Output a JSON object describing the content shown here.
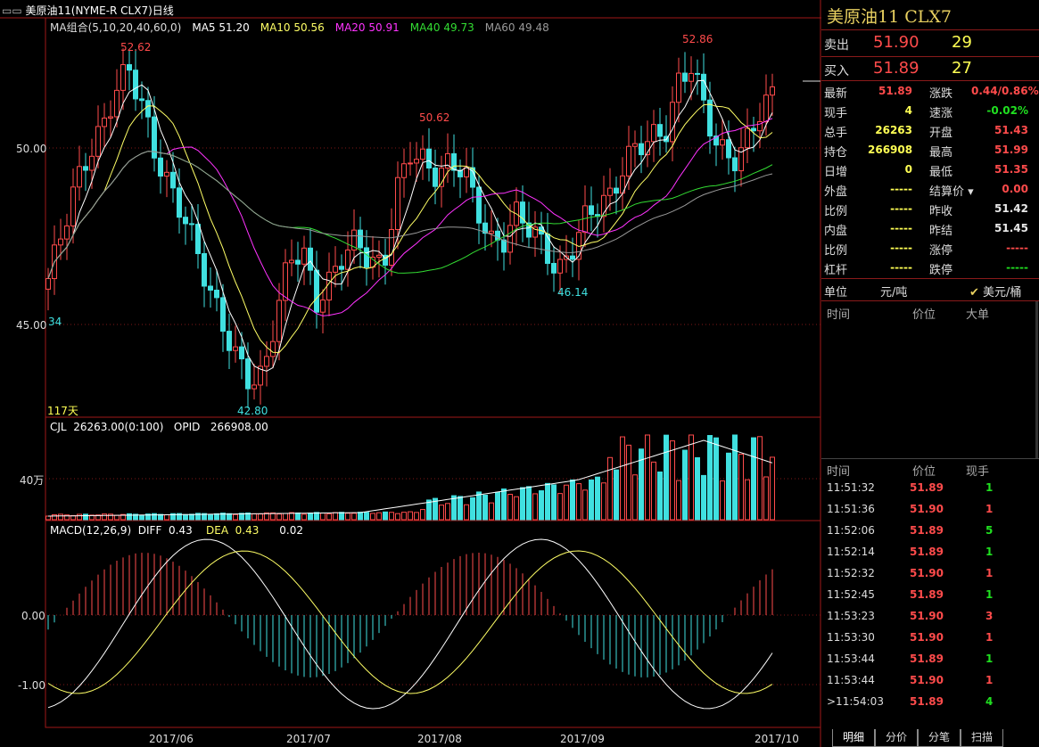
{
  "window": {
    "title": "美原油11(NYME-R CLX7)日线"
  },
  "ma_legend": {
    "group": "MA组合(5,10,20,40,60,0)",
    "ma5": "MA5 51.20",
    "ma10": "MA10 50.56",
    "ma20": "MA20 50.91",
    "ma40": "MA40 49.73",
    "ma60": "MA60 49.48",
    "colors": {
      "ma5": "#ffffff",
      "ma10": "#ffff66",
      "ma20": "#ff33ff",
      "ma40": "#33dd33",
      "ma60": "#999999"
    }
  },
  "price_axis": {
    "labels": [
      "50.00",
      "45.00"
    ]
  },
  "price_annotations": {
    "high1": "52.62",
    "high2": "50.62",
    "high3": "52.86",
    "low1": "42.80",
    "low2": "46.14",
    "left_34": "34",
    "days": "117天"
  },
  "vol_legend": {
    "cjl": "CJL",
    "cjl_val": "26263.00(0:100)",
    "opid": "OPID",
    "opid_val": "266908.00"
  },
  "vol_axis": {
    "label": "40万"
  },
  "macd_legend": {
    "name": "MACD(12,26,9)",
    "diff": "DIFF",
    "diff_val": "0.43",
    "dea": "DEA",
    "dea_val": "0.43",
    "macd_val": "0.02"
  },
  "macd_axis": {
    "labels": [
      "0.00",
      "-1.00"
    ]
  },
  "date_axis": {
    "labels": [
      "2017/06",
      "2017/07",
      "2017/08",
      "2017/09",
      "2017/10"
    ]
  },
  "quote": {
    "title": "美原油11  CLX7",
    "sell_label": "卖出",
    "sell_price": "51.90",
    "sell_qty": "29",
    "buy_label": "买入",
    "buy_price": "51.89",
    "buy_qty": "27",
    "rows": [
      {
        "l1": "最新",
        "v1": "51.89",
        "c1": "red",
        "l2": "涨跌",
        "v2": "0.44/0.86%",
        "c2": "red"
      },
      {
        "l1": "现手",
        "v1": "4",
        "c1": "yel",
        "l2": "速涨",
        "v2": "-0.02%",
        "c2": "grn"
      },
      {
        "l1": "总手",
        "v1": "26263",
        "c1": "yel",
        "l2": "开盘",
        "v2": "51.43",
        "c2": "red"
      },
      {
        "l1": "持仓",
        "v1": "266908",
        "c1": "yel",
        "l2": "最高",
        "v2": "51.99",
        "c2": "red"
      },
      {
        "l1": "日增",
        "v1": "0",
        "c1": "yel",
        "l2": "最低",
        "v2": "51.35",
        "c2": "red"
      },
      {
        "l1": "外盘",
        "v1": "-----",
        "c1": "yel",
        "l2": "结算价",
        "v2": "0.00",
        "c2": "red"
      },
      {
        "l1": "比例",
        "v1": "-----",
        "c1": "yel",
        "l2": "昨收",
        "v2": "51.42",
        "c2": "wht"
      },
      {
        "l1": "内盘",
        "v1": "-----",
        "c1": "yel",
        "l2": "昨结",
        "v2": "51.45",
        "c2": "wht"
      },
      {
        "l1": "比例",
        "v1": "-----",
        "c1": "yel",
        "l2": "涨停",
        "v2": "-----",
        "c2": "red"
      },
      {
        "l1": "杠杆",
        "v1": "-----",
        "c1": "yel",
        "l2": "跌停",
        "v2": "-----",
        "c2": "grn"
      }
    ],
    "unit_label": "单位",
    "unit_value": "元/吨",
    "unit_alt": "✔ 美元/桶"
  },
  "bigorder": {
    "h_time": "时间",
    "h_price": "价位",
    "h_big": "大单"
  },
  "ticks": {
    "h_time": "时间",
    "h_price": "价位",
    "h_qty": "现手",
    "rows": [
      {
        "t": "11:51:32",
        "p": "51.89",
        "q": "1",
        "qc": "grn"
      },
      {
        "t": "11:51:36",
        "p": "51.90",
        "q": "1",
        "qc": "red"
      },
      {
        "t": "11:52:06",
        "p": "51.89",
        "q": "5",
        "qc": "grn"
      },
      {
        "t": "11:52:14",
        "p": "51.89",
        "q": "1",
        "qc": "grn"
      },
      {
        "t": "11:52:32",
        "p": "51.90",
        "q": "1",
        "qc": "red"
      },
      {
        "t": "11:52:45",
        "p": "51.89",
        "q": "1",
        "qc": "grn"
      },
      {
        "t": "11:53:23",
        "p": "51.90",
        "q": "3",
        "qc": "red"
      },
      {
        "t": "11:53:30",
        "p": "51.90",
        "q": "1",
        "qc": "red"
      },
      {
        "t": "11:53:44",
        "p": "51.89",
        "q": "1",
        "qc": "grn"
      },
      {
        "t": "11:53:44",
        "p": "51.90",
        "q": "1",
        "qc": "red"
      },
      {
        "t": ">11:54:03",
        "p": "51.89",
        "q": "4",
        "qc": "grn"
      }
    ]
  },
  "tabs": [
    "明细",
    "分价",
    "分笔",
    "扫描"
  ]
}
